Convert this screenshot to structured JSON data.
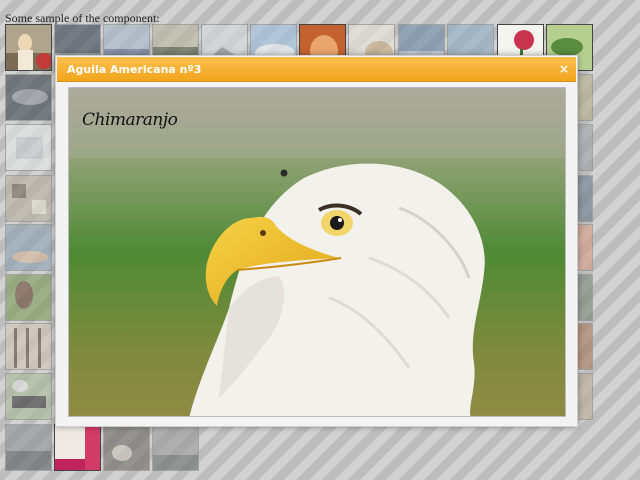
{
  "intro_text": "Some sample of the component:",
  "modal": {
    "title": "Aguila Americana nº3",
    "close_label": "×",
    "watermark": "Chimaranjo"
  },
  "thumbnails": [
    {
      "name": "woman-portrait",
      "colors": [
        "#b8a890",
        "#e9d6b0"
      ]
    },
    {
      "name": "storm-sky",
      "colors": [
        "#3a4656",
        "#8b939c"
      ]
    },
    {
      "name": "coast-rocks",
      "colors": [
        "#8da2bd",
        "#c9d2dc"
      ]
    },
    {
      "name": "landscape-hills",
      "colors": [
        "#5d6a50",
        "#b6b39b"
      ]
    },
    {
      "name": "misty-mountain",
      "colors": [
        "#cfd3d6",
        "#7e8b90"
      ]
    },
    {
      "name": "clouds-sky",
      "colors": [
        "#a9c3e0",
        "#e6eef5"
      ]
    },
    {
      "name": "red-horse",
      "colors": [
        "#b7542d",
        "#e49b6b"
      ]
    },
    {
      "name": "white-animal",
      "colors": [
        "#e8e1d7",
        "#c2ab8c"
      ]
    },
    {
      "name": "seascape",
      "colors": [
        "#6e8aa3",
        "#c9d5df"
      ]
    },
    {
      "name": "shore",
      "colors": [
        "#8aa8c0",
        "#dfe6ea"
      ]
    },
    {
      "name": "rose-flower",
      "colors": [
        "#c33a54",
        "#f1f1ee"
      ]
    },
    {
      "name": "green-leaves",
      "colors": [
        "#5f8f43",
        "#b9cf96"
      ]
    }
  ]
}
